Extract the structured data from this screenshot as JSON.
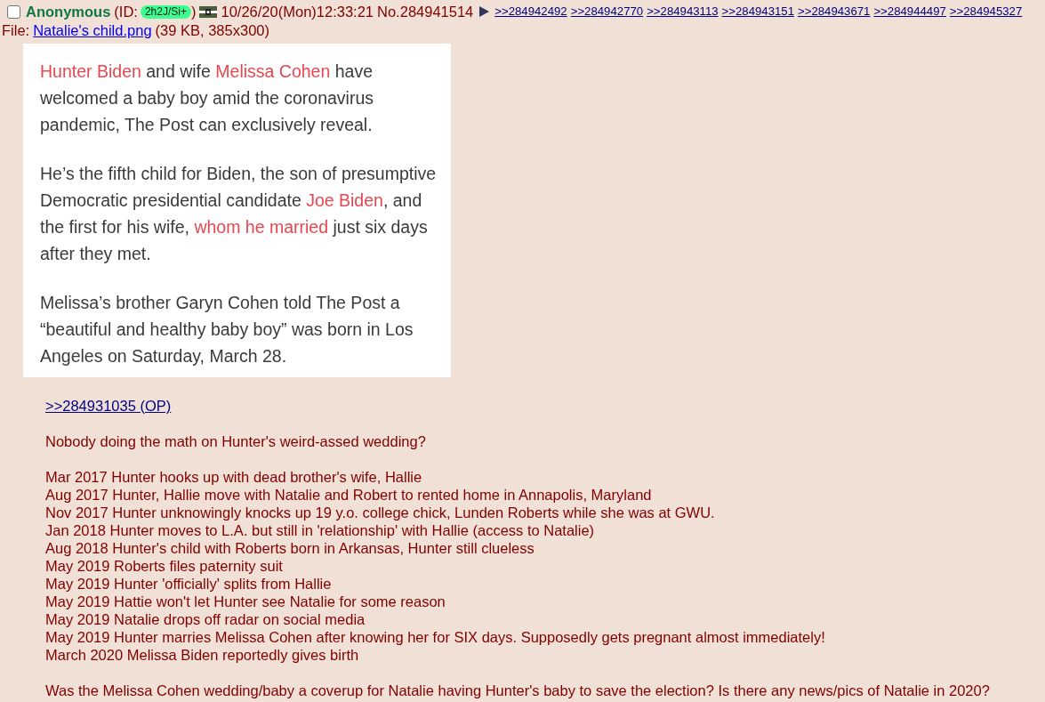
{
  "post": {
    "selected": false,
    "name": "Anonymous",
    "id_label": "(ID:",
    "id": "2h2J/Si+",
    "id_close": ")",
    "datetime": "10/26/20(Mon)12:33:21",
    "number": "No.284941514",
    "replies": [
      ">>284942492",
      ">>284942770",
      ">>284943113",
      ">>284943151",
      ">>284943671",
      ">>284944497",
      ">>284945327"
    ],
    "file": {
      "label": "File:",
      "name": "Natalie's child.png",
      "info": "(39 KB, 385x300)"
    }
  },
  "image": {
    "paragraphs": [
      [
        {
          "text": "Hunter Biden",
          "link": true
        },
        {
          "text": " and wife ",
          "link": false
        },
        {
          "text": "Melissa Cohen",
          "link": true
        },
        {
          "text": " have welcomed a baby boy amid the coronavirus pandemic, The Post can exclusively reveal.",
          "link": false
        }
      ],
      [
        {
          "text": "He’s the fifth child for Biden, the son of presumptive Democratic presidential candidate ",
          "link": false
        },
        {
          "text": "Joe Biden",
          "link": true
        },
        {
          "text": ", and the first for his wife, ",
          "link": false
        },
        {
          "text": "whom he married",
          "link": true
        },
        {
          "text": " just six days after they met.",
          "link": false
        }
      ],
      [
        {
          "text": "Melissa’s brother Garyn Cohen told The Post a “beautiful and healthy baby boy” was born in Los Angeles on Saturday, March 28.",
          "link": false
        }
      ]
    ]
  },
  "message": {
    "quote": ">>284931035 (OP)",
    "blocks": [
      [
        "Nobody doing the math on Hunter's weird-assed wedding?"
      ],
      [
        "Mar 2017 Hunter hooks up with dead brother's wife, Hallie",
        "Aug 2017 Hunter, Hallie move with Natalie and Robert to rented home in Annapolis, Maryland",
        "Nov 2017 Hunter unknowingly knocks up 19 y.o. college chick, Lunden Roberts while she was at GWU.",
        "Jan 2018 Hunter moves to L.A. but still in 'relationship' with Hallie (access to Natalie)",
        "Aug 2018 Hunter's child with Roberts born in Arkansas, Hunter still clueless",
        "May 2019 Roberts files paternity suit",
        "May 2019 Hunter 'officially' splits from Hallie",
        "May 2019 Hattie won't let Hunter see Natalie for some reason",
        "May 2019 Natalie drops off radar on social media",
        "May 2019 Hunter marries Melissa Cohen after knowing her for SIX days. Supposedly gets pregnant almost immediately!",
        "March 2020 Melissa Biden reportedly gives birth"
      ],
      [
        "Was the Melissa Cohen wedding/baby a coverup for Natalie having Hunter's baby to save the election? Is there any news/pics of Natalie in 2020?"
      ]
    ]
  }
}
